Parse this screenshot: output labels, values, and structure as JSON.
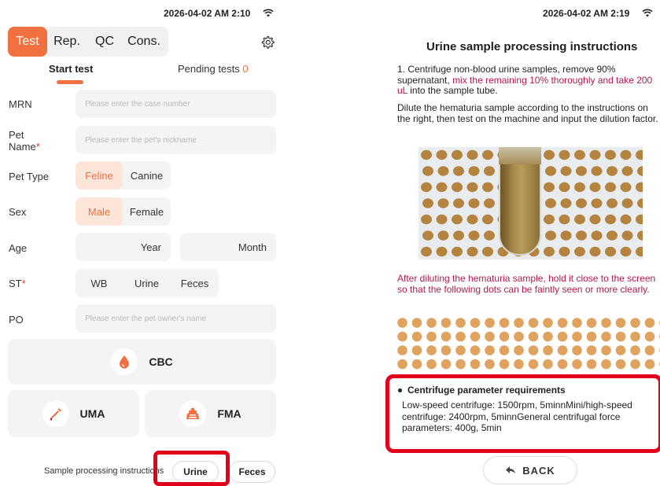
{
  "left": {
    "status_time": "2026-04-02 AM 2:10",
    "tabs": [
      "Test",
      "Rep.",
      "QC",
      "Cons."
    ],
    "subtab_start": "Start test",
    "subtab_pending": "Pending tests",
    "pending_count": "0",
    "mrn_label": "MRN",
    "mrn_placeholder": "Please enter the case number",
    "pet_name_label_1": "Pet",
    "pet_name_label_2": "Name",
    "pet_name_placeholder": "Please enter the pet's nickname",
    "pet_type_label": "Pet Type",
    "pet_type_options": [
      "Feline",
      "Canine"
    ],
    "sex_label": "Sex",
    "sex_options": [
      "Male",
      "Female"
    ],
    "age_label": "Age",
    "age_year": "Year",
    "age_month": "Month",
    "st_label": "ST",
    "st_options": [
      "WB",
      "Urine",
      "Feces"
    ],
    "po_label": "PO",
    "po_placeholder": "Please enter the pet owner's name",
    "cards": [
      "CBC",
      "UMA",
      "FMA"
    ],
    "sample_instructions_label": "Sample processing instructions",
    "sample_buttons": [
      "Urine",
      "Feces"
    ],
    "required_mark": "*",
    "accent_color": "#f0703f"
  },
  "right": {
    "status_time": "2026-04-02 AM 2:19",
    "title": "Urine sample processing instructions",
    "step1_a": "1. Centrifuge non-blood urine samples, remove 90% supernatant, ",
    "step1_hl": "mix the remaining 10% thoroughly and take 200 uL",
    "step1_b": " into the sample tube.",
    "dilute_text": "Dilute the hematuria sample according to the instructions on the right, then test on the machine and input the dilution factor.",
    "after_text": "After diluting the hematuria sample, hold it close to the screen so that the following dots can be faintly seen or more clearly.",
    "param_title": "Centrifuge parameter requirements",
    "param_text": "Low-speed centrifuge: 1500rpm, 5minnMini/high-speed centrifuge: 2400rpm, 5minnGeneral centrifugal force parameters: 400g, 5min",
    "back_label": "BACK",
    "highlight_color": "#b3194f",
    "dot_color": "#e0a25f"
  }
}
